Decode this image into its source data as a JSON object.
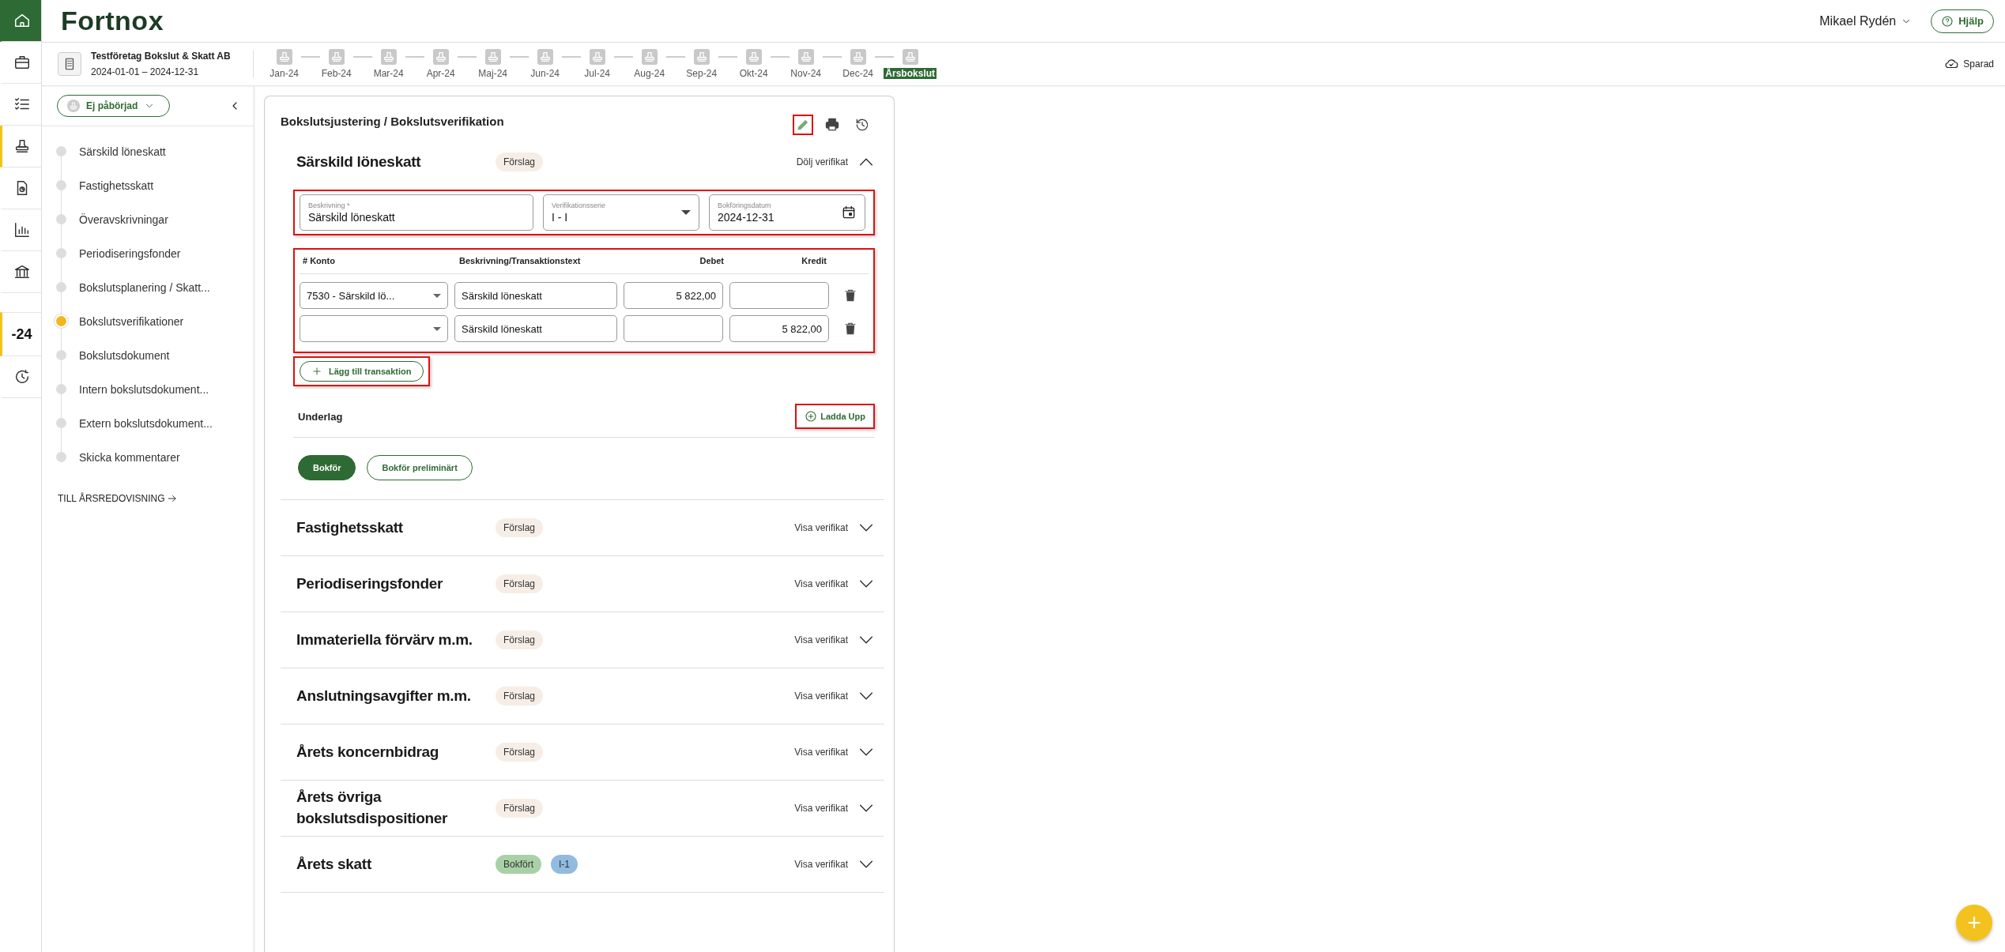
{
  "header": {
    "logo": "Fortnox",
    "user": "Mikael Rydén",
    "help": "Hjälp"
  },
  "rail": [
    {
      "kind": "home",
      "selected": true,
      "highlighted": false
    },
    {
      "kind": "briefcase",
      "selected": false,
      "highlighted": false
    },
    {
      "kind": "checklist",
      "selected": false,
      "highlighted": false
    },
    {
      "kind": "stamp",
      "selected": false,
      "highlighted": true
    },
    {
      "kind": "document",
      "selected": false,
      "highlighted": false
    },
    {
      "kind": "chart",
      "selected": false,
      "highlighted": false
    },
    {
      "kind": "bank",
      "selected": false,
      "highlighted": false
    },
    {
      "kind": "text",
      "label": "-24",
      "selected": false,
      "highlighted": true
    },
    {
      "kind": "history",
      "selected": false,
      "highlighted": false
    }
  ],
  "company": {
    "name": "Testföretag Bokslut & Skatt AB",
    "period": "2024-01-01 – 2024-12-31"
  },
  "timeline": [
    {
      "label": "Jan-24",
      "selected": false
    },
    {
      "label": "Feb-24",
      "selected": false
    },
    {
      "label": "Mar-24",
      "selected": false
    },
    {
      "label": "Apr-24",
      "selected": false
    },
    {
      "label": "Maj-24",
      "selected": false
    },
    {
      "label": "Jun-24",
      "selected": false
    },
    {
      "label": "Jul-24",
      "selected": false
    },
    {
      "label": "Aug-24",
      "selected": false
    },
    {
      "label": "Sep-24",
      "selected": false
    },
    {
      "label": "Okt-24",
      "selected": false
    },
    {
      "label": "Nov-24",
      "selected": false
    },
    {
      "label": "Dec-24",
      "selected": false
    },
    {
      "label": "Årsbokslut",
      "selected": true
    }
  ],
  "save_status": "Sparad",
  "nav": {
    "status": "Ej påbörjad",
    "items": [
      {
        "label": "Särskild löneskatt",
        "selected": false
      },
      {
        "label": "Fastighetsskatt",
        "selected": false
      },
      {
        "label": "Överavskrivningar",
        "selected": false
      },
      {
        "label": "Periodiseringsfonder",
        "selected": false
      },
      {
        "label": "Bokslutsplanering / Skatt...",
        "selected": false
      },
      {
        "label": "Bokslutsverifikationer",
        "selected": true
      },
      {
        "label": "Bokslutsdokument",
        "selected": false
      },
      {
        "label": "Intern bokslutsdokument...",
        "selected": false
      },
      {
        "label": "Extern bokslutsdokument...",
        "selected": false
      },
      {
        "label": "Skicka kommentarer",
        "selected": false
      }
    ],
    "footer_link": "TILL ÅRSREDOVISNING"
  },
  "card": {
    "title": "Bokslutsjustering / Bokslutsverifikation",
    "edit_highlighted": true,
    "sections": [
      {
        "title": "Särskild löneskatt",
        "tags": [
          {
            "label": "Förslag",
            "color": "#f6eee6"
          }
        ],
        "toggle": "Dölj verifikat",
        "expanded": true,
        "details": {
          "fields_highlighted": true,
          "fields": [
            {
              "kind": "text",
              "label": "Beskrivning *",
              "value": "Särskild löneskatt"
            },
            {
              "kind": "select",
              "label": "Verifikationsserie",
              "value": "I - I"
            },
            {
              "kind": "date",
              "label": "Bokföringsdatum",
              "value": "2024-12-31"
            }
          ],
          "transactions_highlighted": true,
          "columns": [
            "# Konto",
            "Beskrivning/Transaktionstext",
            "Debet",
            "Kredit"
          ],
          "rows": [
            {
              "account": "7530 -  Särskild lö...",
              "text": "Särskild löneskatt",
              "debit": "5 822,00"
            },
            {
              "text": "Särskild löneskatt",
              "credit": "5 822,00"
            }
          ],
          "add_button": {
            "label": "Lägg till transaktion",
            "highlighted": true
          },
          "attachments": {
            "label": "Underlag",
            "upload": "Ladda Upp",
            "highlighted": true
          },
          "actions": [
            {
              "kind": "primary",
              "label": "Bokför"
            },
            {
              "kind": "secondary",
              "label": "Bokför preliminärt"
            }
          ]
        }
      },
      {
        "title": "Fastighetsskatt",
        "tags": [
          {
            "label": "Förslag",
            "color": "#f6eee6"
          }
        ],
        "toggle": "Visa verifikat",
        "expanded": false
      },
      {
        "title": "Periodiseringsfonder",
        "tags": [
          {
            "label": "Förslag",
            "color": "#f6eee6"
          }
        ],
        "toggle": "Visa verifikat",
        "expanded": false
      },
      {
        "title": "Immateriella förvärv m.m.",
        "tags": [
          {
            "label": "Förslag",
            "color": "#f6eee6"
          }
        ],
        "toggle": "Visa verifikat",
        "expanded": false
      },
      {
        "title": "Anslutningsavgifter m.m.",
        "tags": [
          {
            "label": "Förslag",
            "color": "#f6eee6"
          }
        ],
        "toggle": "Visa verifikat",
        "expanded": false
      },
      {
        "title": "Årets koncernbidrag",
        "tags": [
          {
            "label": "Förslag",
            "color": "#f6eee6"
          }
        ],
        "toggle": "Visa verifikat",
        "expanded": false
      },
      {
        "title": "Årets övriga bokslutsdispositioner",
        "tags": [
          {
            "label": "Förslag",
            "color": "#f6eee6"
          }
        ],
        "toggle": "Visa verifikat",
        "expanded": false
      },
      {
        "title": "Årets skatt",
        "tags": [
          {
            "label": "Bokfört",
            "color": "#a9d1a7"
          },
          {
            "label": "I-1",
            "color": "#91bbdf"
          }
        ],
        "toggle": "Visa verifikat",
        "expanded": false
      }
    ]
  },
  "fab": "+"
}
